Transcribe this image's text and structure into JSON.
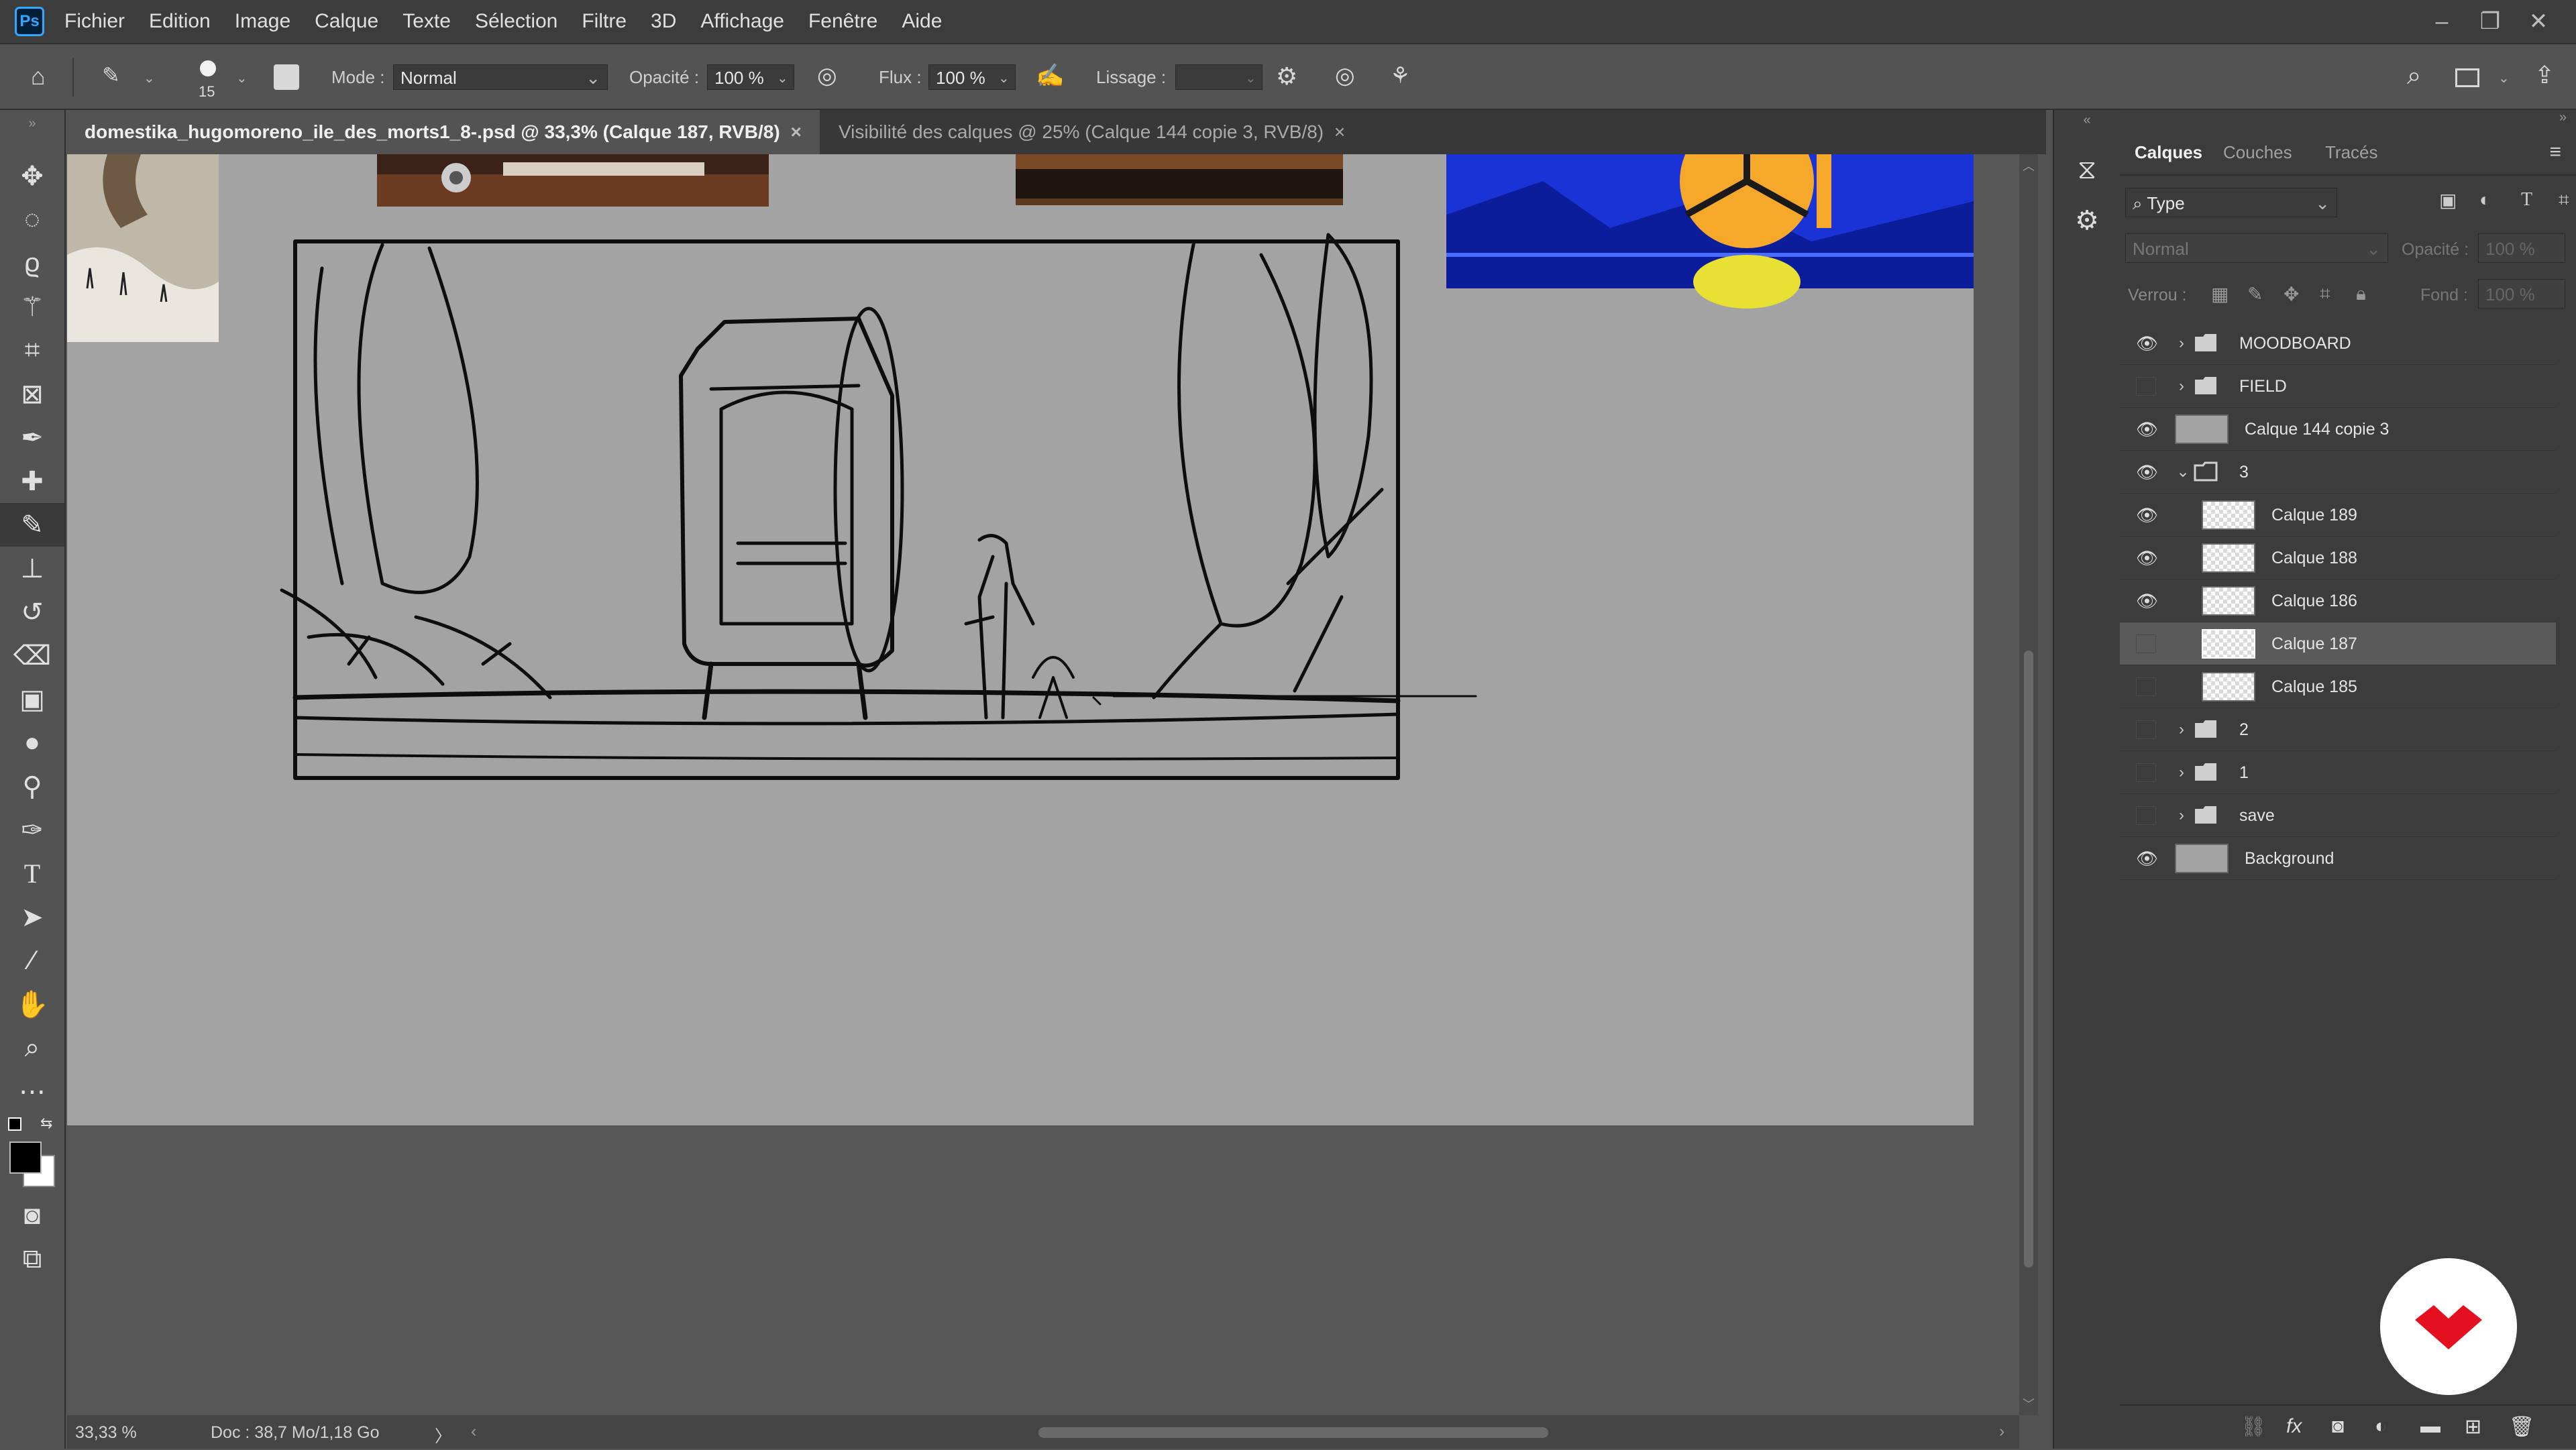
{
  "app": {
    "logo": "Ps"
  },
  "menu": {
    "items": [
      "Fichier",
      "Edition",
      "Image",
      "Calque",
      "Texte",
      "Sélection",
      "Filtre",
      "3D",
      "Affichage",
      "Fenêtre",
      "Aide"
    ]
  },
  "options": {
    "brush_size": "15",
    "mode_label": "Mode :",
    "mode_value": "Normal",
    "opacity_label": "Opacité :",
    "opacity_value": "100 %",
    "flux_label": "Flux :",
    "flux_value": "100 %",
    "lissage_label": "Lissage :"
  },
  "tabs": [
    {
      "label": "domestika_hugomoreno_ile_des_morts1_8-.psd @ 33,3% (Calque 187, RVB/8)",
      "close": "×",
      "active": true
    },
    {
      "label": "Visibilité des calques @ 25% (Calque 144 copie 3, RVB/8)",
      "close": "×",
      "active": false
    }
  ],
  "status": {
    "zoom": "33,33 %",
    "doc": "Doc : 38,7 Mo/1,18 Go",
    "arrow": "〉"
  },
  "panel": {
    "tabs": [
      "Calques",
      "Couches",
      "Tracés"
    ],
    "filter_label": "Type",
    "blend_mode": "Normal",
    "opacity_label": "Opacité :",
    "opacity_value": "100 %",
    "lock_label": "Verrou :",
    "fill_label": "Fond :",
    "fill_value": "100 %",
    "layers": [
      {
        "name": "MOODBOARD",
        "visible": true,
        "kind": "group-collapsed",
        "indent": 0
      },
      {
        "name": "FIELD",
        "visible": false,
        "kind": "group-collapsed",
        "indent": 0
      },
      {
        "name": "Calque 144 copie 3",
        "visible": true,
        "kind": "layer",
        "indent": 0
      },
      {
        "name": "3",
        "visible": true,
        "kind": "group-expanded",
        "indent": 0
      },
      {
        "name": "Calque 189",
        "visible": true,
        "kind": "layer",
        "indent": 1
      },
      {
        "name": "Calque 188",
        "visible": true,
        "kind": "layer",
        "indent": 1
      },
      {
        "name": "Calque 186",
        "visible": true,
        "kind": "layer",
        "indent": 1
      },
      {
        "name": "Calque 187",
        "visible": false,
        "kind": "layer",
        "indent": 1,
        "selected": true
      },
      {
        "name": "Calque 185",
        "visible": false,
        "kind": "layer",
        "indent": 1
      },
      {
        "name": "2",
        "visible": false,
        "kind": "group-collapsed",
        "indent": 0
      },
      {
        "name": "1",
        "visible": false,
        "kind": "group-collapsed",
        "indent": 0
      },
      {
        "name": "save",
        "visible": false,
        "kind": "group-collapsed",
        "indent": 0
      },
      {
        "name": "Background",
        "visible": true,
        "kind": "background",
        "indent": 0
      }
    ]
  },
  "colors": {
    "accent": "#31a8ff",
    "domestika": "#e5101f",
    "canvas": "#a3a3a3",
    "selected_row": "#5a5a5a"
  }
}
